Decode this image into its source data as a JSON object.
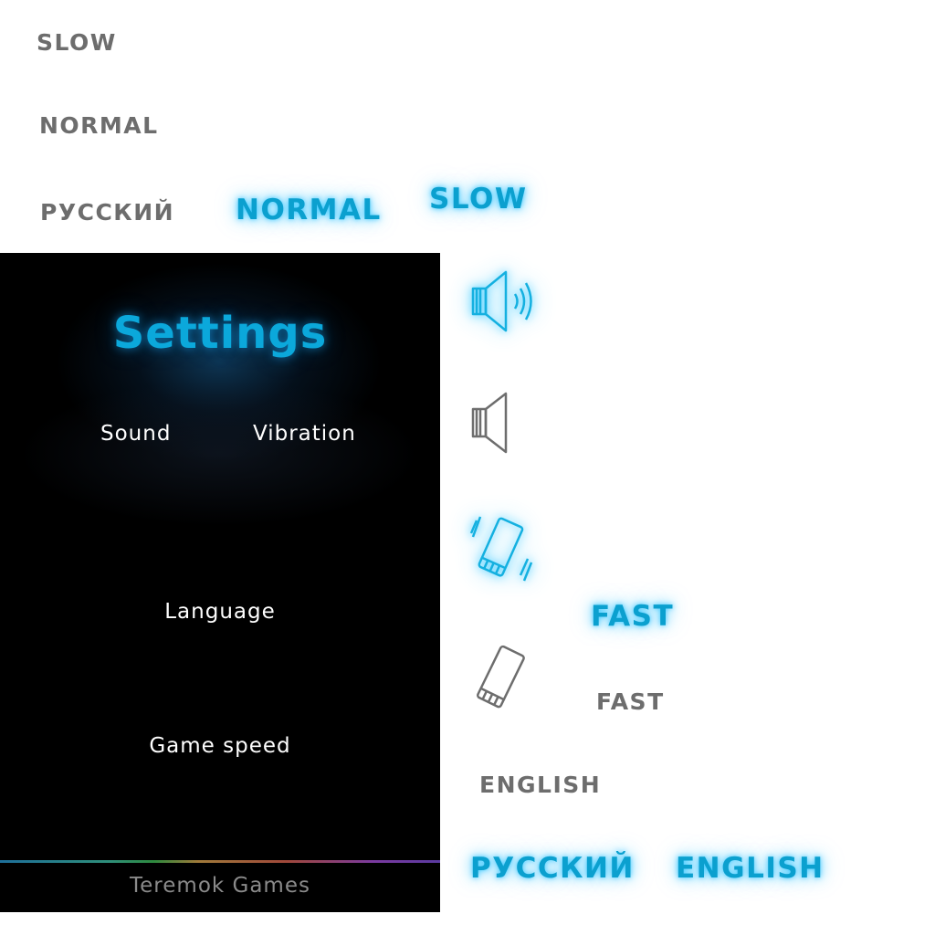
{
  "loose_labels": {
    "slow_gray": "SLOW",
    "normal_gray": "NORMAL",
    "russian_gray": "РУССКИЙ",
    "normal_active": "NORMAL",
    "slow_active": "SLOW",
    "fast_active": "FAST",
    "fast_gray": "FAST",
    "english_gray": "ENGLISH",
    "russian_active": "РУССКИЙ",
    "english_active": "ENGLISH"
  },
  "settings": {
    "title": "Settings",
    "sound_label": "Sound",
    "vibration_label": "Vibration",
    "language_label": "Language",
    "game_speed_label": "Game speed",
    "footer": "Teremok Games"
  },
  "icons": {
    "sound_on": "speaker-on-icon",
    "sound_off": "speaker-off-icon",
    "vibration_on": "phone-vibrate-icon",
    "vibration_off": "phone-icon"
  },
  "colors": {
    "active": "#0ba0cf",
    "inactive": "#6d6d6d",
    "panel_bg": "#000000",
    "panel_text": "#ffffff",
    "footer_text": "#8a8a8a"
  }
}
